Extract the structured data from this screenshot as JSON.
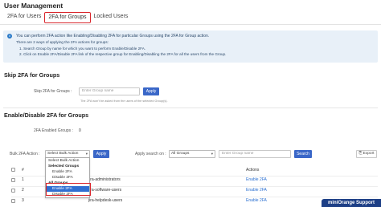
{
  "header": {
    "title": "User Management",
    "tabs": [
      {
        "label": "2FA for Users"
      },
      {
        "label": "2FA for Groups"
      },
      {
        "label": "Locked Users"
      }
    ]
  },
  "info": {
    "icon": "info-icon",
    "main": "You can perform 2FA action like Enabling/Disabling 2FA for particular Groups using the 2FA for Group action.",
    "sub": "There are 2 ways of applying the 2FA actions for groups:",
    "step1": "1. Search Group by name for which you want to perform Enable/Disable 2FA.",
    "step2": "2. Click on Enable 2FA/Disable 2FA link of the respective group for Enabling/Disabling the 2FA for all the users from the Group."
  },
  "skip": {
    "title": "Skip 2FA for Groups",
    "label": "Skip 2FA for Groups :",
    "placeholder": "Enter Group name",
    "apply": "Apply",
    "hint": "The 2FA won't be asked from the users of the selected Group(s)."
  },
  "enable": {
    "title": "Enable/Disable 2FA for Groups",
    "count_label": "2FA Enabled Groups :",
    "count": "0"
  },
  "bulk": {
    "label": "Bulk 2FA Action :",
    "selected": "Select Bulk Action",
    "apply": "Apply",
    "search_on_label": "Apply search on :",
    "search_on_value": "All Groups",
    "search_placeholder": "Enter Group name",
    "search": "Search",
    "export": "Export"
  },
  "dropdown": {
    "items": [
      {
        "label": "Select Bulk Action"
      },
      {
        "label": "Selected Groups"
      },
      {
        "label": "Enable 2FA"
      },
      {
        "label": "Disable 2FA"
      },
      {
        "label": "All Groups"
      },
      {
        "label": "Enable 2FA"
      },
      {
        "label": "Disable 2FA"
      }
    ]
  },
  "table": {
    "col_num": "#",
    "col_actions": "Actions",
    "rows": [
      {
        "num": "1",
        "group": "jira-administrators",
        "action": "Enable 2FA"
      },
      {
        "num": "2",
        "group": "jira-software-users",
        "action": "Enable 2FA"
      },
      {
        "num": "3",
        "group": "jira-helpdesk-users",
        "action": "Enable 2FA"
      }
    ]
  },
  "support": "miniOrange Support",
  "colors": {
    "accent": "#3a67c8",
    "highlight": "#d9262c",
    "link": "#2a6fd1",
    "support_bg": "#1d3f86"
  }
}
